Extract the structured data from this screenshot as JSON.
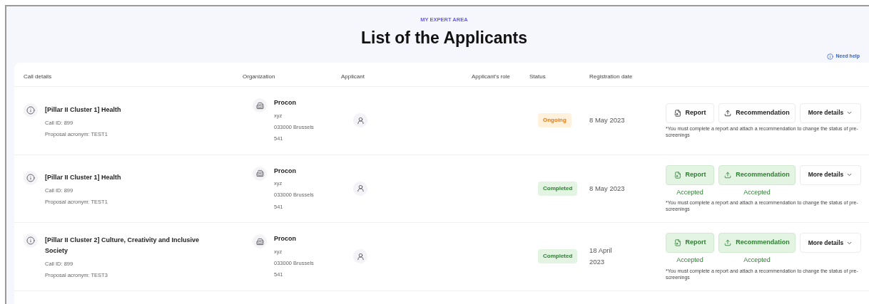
{
  "eyebrow": "MY EXPERT AREA",
  "title": "List of the Applicants",
  "help_link": "Need help",
  "columns": [
    "Call details",
    "Organization",
    "Applicant",
    "Applicant's role",
    "Status",
    "Registration date"
  ],
  "rows": [
    {
      "call_title": "[Pillar II Cluster 1] Health",
      "call_id": "Call ID: 899",
      "acronym": "Proposal acronym: TEST1",
      "org_name": "Procon",
      "org_lines": [
        "xyz",
        "033000 Brussels",
        "541"
      ],
      "status": {
        "label": "Ongoing",
        "kind": "ongoing"
      },
      "date": "8 May 2023",
      "report": {
        "label": "Report",
        "accepted": false
      },
      "recommendation": {
        "label": "Recommendation",
        "accepted": false
      },
      "more": "More details",
      "note": "*You must complete a report and attach a recommendation to change the status of pre-screenings"
    },
    {
      "call_title": "[Pillar II Cluster 1] Health",
      "call_id": "Call ID: 899",
      "acronym": "Proposal acronym: TEST1",
      "org_name": "Procon",
      "org_lines": [
        "xyz",
        "033000 Brussels",
        "541"
      ],
      "status": {
        "label": "Completed",
        "kind": "completed"
      },
      "date": "8 May 2023",
      "report": {
        "label": "Report",
        "accepted": true,
        "caption": "Accepted"
      },
      "recommendation": {
        "label": "Recommendation",
        "accepted": true,
        "caption": "Accepted"
      },
      "more": "More details",
      "note": "*You must complete a report and attach a recommendation to change the status of pre-screenings"
    },
    {
      "call_title": "[Pillar II Cluster 2] Culture, Creativity and Inclusive Society",
      "call_id": "Call ID: 899",
      "acronym": "Proposal acronym: TEST3",
      "org_name": "Procon",
      "org_lines": [
        "xyz",
        "033000 Brussels",
        "541"
      ],
      "status": {
        "label": "Completed",
        "kind": "completed"
      },
      "date": "18 April 2023",
      "report": {
        "label": "Report",
        "accepted": true,
        "caption": "Accepted"
      },
      "recommendation": {
        "label": "Recommendation",
        "accepted": true,
        "caption": "Accepted"
      },
      "more": "More details",
      "note": "*You must complete a report and attach a recommendation to change the status of pre-screenings"
    }
  ]
}
